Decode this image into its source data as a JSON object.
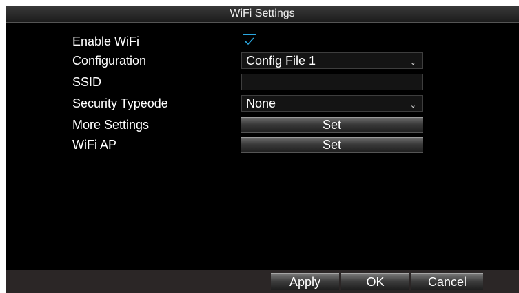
{
  "title": "WiFi Settings",
  "rows": {
    "enable_wifi": {
      "label": "Enable WiFi",
      "checked": true
    },
    "configuration": {
      "label": "Configuration",
      "value": "Config File 1",
      "icon": "chevron-down-icon"
    },
    "ssid": {
      "label": "SSID",
      "value": ""
    },
    "security": {
      "label": "Security Typeode",
      "value": "None",
      "icon": "chevron-down-icon"
    },
    "more_settings": {
      "label": "More Settings",
      "button": "Set"
    },
    "wifi_ap": {
      "label": "WiFi AP",
      "button": "Set"
    }
  },
  "footer": {
    "apply": "Apply",
    "ok": "OK",
    "cancel": "Cancel"
  },
  "colors": {
    "background": "#000000",
    "checkbox_accent": "#2aa7e0",
    "footer": "#2b2626"
  }
}
